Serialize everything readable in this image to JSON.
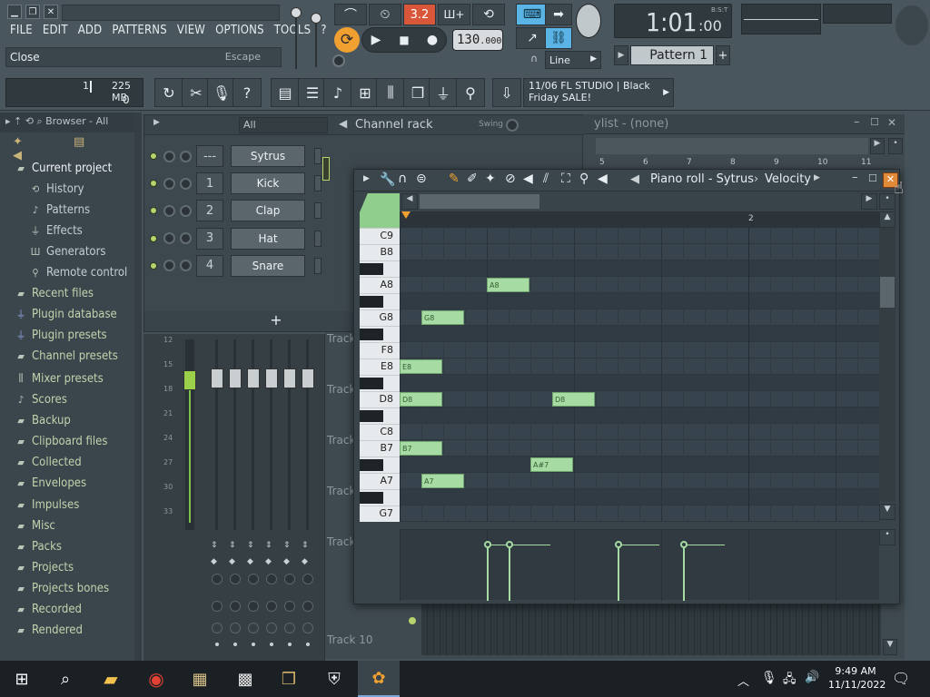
{
  "menu": [
    "FILE",
    "EDIT",
    "ADD",
    "PATTERNS",
    "VIEW",
    "OPTIONS",
    "TOOLS",
    "?"
  ],
  "hint": {
    "text": "Close",
    "shortcut": "Escape"
  },
  "transport": {
    "pattern_song_mode": "3.2",
    "tempo": "130",
    "tempo_decimals": ".000",
    "time": "1:01",
    "time_small": ":00",
    "time_label": "B:S:T",
    "pattern": "Pattern 1",
    "snap": "Line"
  },
  "memory": {
    "line1_value": "1",
    "line1_size": "225 MB",
    "line2_value": "0"
  },
  "news": {
    "line1": "11/06  FL STUDIO | Black",
    "line2": "Friday SALE!"
  },
  "browser": {
    "header": "Browser - All",
    "items": [
      {
        "label": "Current project",
        "icon": "folder",
        "type": "head"
      },
      {
        "label": "History",
        "icon": "history",
        "type": "sub"
      },
      {
        "label": "Patterns",
        "icon": "note",
        "type": "sub"
      },
      {
        "label": "Effects",
        "icon": "plug",
        "type": "sub"
      },
      {
        "label": "Generators",
        "icon": "gen",
        "type": "sub"
      },
      {
        "label": "Remote control",
        "icon": "remote",
        "type": "sub"
      },
      {
        "label": "Recent files",
        "icon": "folder",
        "type": "top"
      },
      {
        "label": "Plugin database",
        "icon": "plug",
        "type": "top"
      },
      {
        "label": "Plugin presets",
        "icon": "plug",
        "type": "top"
      },
      {
        "label": "Channel presets",
        "icon": "folder",
        "type": "top"
      },
      {
        "label": "Mixer presets",
        "icon": "mixer",
        "type": "top"
      },
      {
        "label": "Scores",
        "icon": "note",
        "type": "top"
      },
      {
        "label": "Backup",
        "icon": "folder",
        "type": "top"
      },
      {
        "label": "Clipboard files",
        "icon": "folder",
        "type": "top"
      },
      {
        "label": "Collected",
        "icon": "folder",
        "type": "top"
      },
      {
        "label": "Envelopes",
        "icon": "folder",
        "type": "top"
      },
      {
        "label": "Impulses",
        "icon": "folder",
        "type": "top"
      },
      {
        "label": "Misc",
        "icon": "folder",
        "type": "top"
      },
      {
        "label": "Packs",
        "icon": "folder",
        "type": "top"
      },
      {
        "label": "Projects",
        "icon": "folder",
        "type": "top"
      },
      {
        "label": "Projects bones",
        "icon": "folder",
        "type": "top"
      },
      {
        "label": "Recorded",
        "icon": "folder",
        "type": "top"
      },
      {
        "label": "Rendered",
        "icon": "folder",
        "type": "top"
      }
    ]
  },
  "channel_rack": {
    "title": "Channel rack",
    "filter": "All",
    "swing_label": "Swing",
    "channels": [
      {
        "num": "---",
        "name": "Sytrus"
      },
      {
        "num": "1",
        "name": "Kick"
      },
      {
        "num": "2",
        "name": "Clap"
      },
      {
        "num": "3",
        "name": "Hat"
      },
      {
        "num": "4",
        "name": "Snare"
      }
    ],
    "add_label": "+"
  },
  "playlist": {
    "title": "ylist - (none)",
    "ruler": [
      "5",
      "6",
      "7",
      "8",
      "9",
      "10",
      "11"
    ],
    "track_label": "Track",
    "last_track": "Track 10"
  },
  "mixer": {
    "ruler": [
      "12",
      "15",
      "18",
      "21",
      "24",
      "27",
      "30",
      "33"
    ]
  },
  "piano_roll": {
    "title": "Piano roll - Sytrus",
    "separator": "›",
    "target": "Velocity",
    "bar_marker": "2",
    "keys": [
      {
        "label": "C9"
      },
      {
        "label": "B8"
      },
      {
        "label": "A8"
      },
      {
        "label": "G8"
      },
      {
        "label": "F8"
      },
      {
        "label": "E8"
      },
      {
        "label": "D8"
      },
      {
        "label": "C8"
      },
      {
        "label": "B7"
      },
      {
        "label": "A7"
      },
      {
        "label": "G7"
      }
    ],
    "notes": [
      {
        "label": "A8",
        "pitch": "A8",
        "step": 4,
        "len": 2
      },
      {
        "label": "G8",
        "pitch": "G8",
        "step": 1,
        "len": 2
      },
      {
        "label": "E8",
        "pitch": "E8",
        "step": 0,
        "len": 2
      },
      {
        "label": "D8",
        "pitch": "D8",
        "step": 0,
        "len": 2
      },
      {
        "label": "D8",
        "pitch": "D8",
        "step": 7,
        "len": 2
      },
      {
        "label": "B7",
        "pitch": "B7",
        "step": 0,
        "len": 2
      },
      {
        "label": "A#7",
        "pitch": "A#7",
        "step": 6,
        "len": 2
      },
      {
        "label": "A7",
        "pitch": "A7",
        "step": 1,
        "len": 2
      }
    ],
    "velocity_steps": [
      0,
      1,
      6,
      9
    ]
  },
  "taskbar": {
    "time": "9:49 AM",
    "date": "11/11/2022"
  },
  "colors": {
    "note": "#a6dca4",
    "accent_orange": "#f0a030",
    "accent_blue": "#5ab4e6",
    "led": "#b6d46e"
  }
}
